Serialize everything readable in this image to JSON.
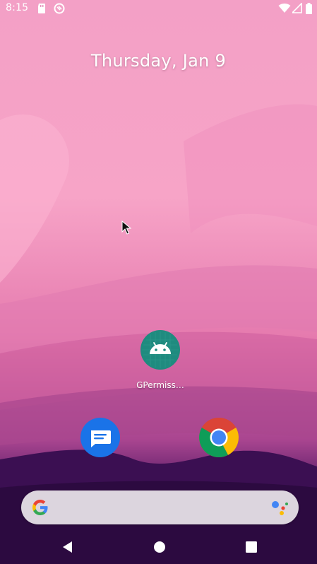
{
  "status_bar": {
    "time": "8:15",
    "icons": [
      "sd-card-icon",
      "sync-icon",
      "wifi-icon",
      "signal-icon",
      "battery-icon"
    ]
  },
  "home": {
    "date": "Thursday, Jan 9",
    "apps": [
      {
        "label": "GPermiss…",
        "icon": "android-icon"
      }
    ],
    "dock": [
      {
        "icon": "messages-icon"
      },
      {
        "icon": "chrome-icon"
      }
    ]
  },
  "search": {
    "logo": "google-g-icon",
    "assistant": "google-assistant-icon"
  },
  "nav": {
    "buttons": [
      "back-icon",
      "home-icon",
      "recents-icon"
    ]
  },
  "colors": {
    "wallpaper_pink": "#f9a1c6",
    "wallpaper_dark": "#2f0a45",
    "android_teal": "#1f8b7f",
    "messages_blue": "#1a73e8",
    "search_bar": "#dcd5de"
  }
}
